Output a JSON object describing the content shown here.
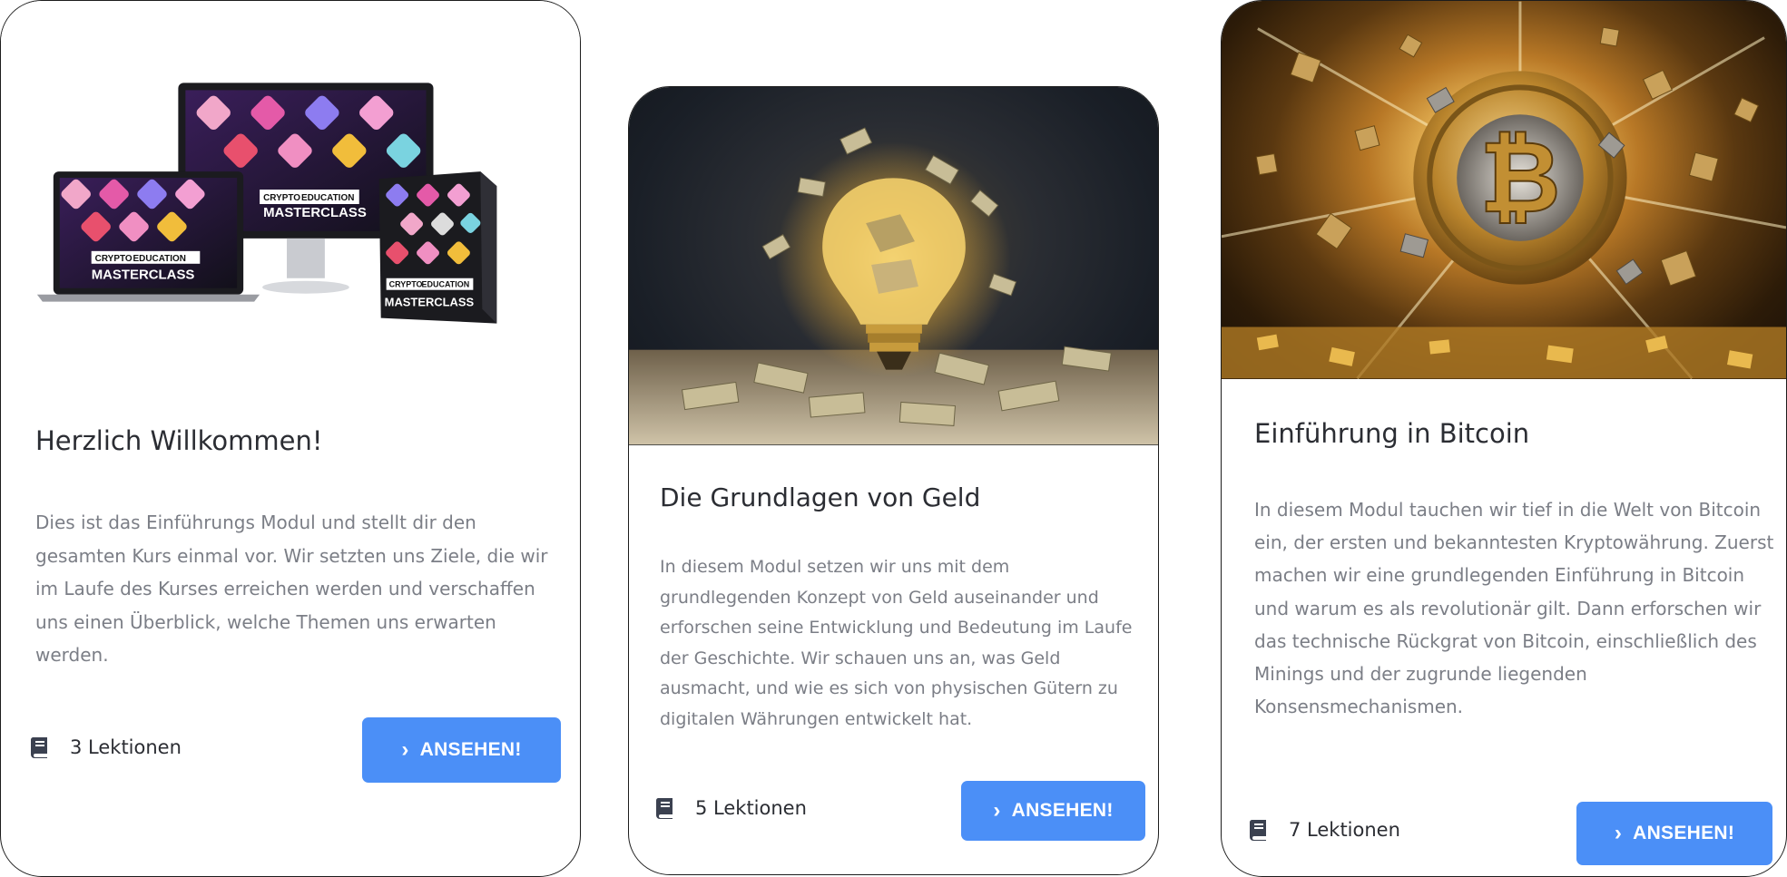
{
  "cards": [
    {
      "title": "Herzlich Willkommen!",
      "description": "Dies ist das Einführungs Modul und stellt dir den gesamten Kurs einmal vor. Wir setzten uns Ziele, die wir im Laufe des Kurses erreichen werden und verschaffen uns einen Überblick, welche Themen uns erwarten werden.",
      "lessons": "3 Lektionen",
      "button_label": "ANSEHEN!",
      "image": {
        "brand_top": "CRYPTO",
        "brand_word": "EDUCATION",
        "product": "MASTERCLASS"
      }
    },
    {
      "title": "Die Grundlagen von Geld",
      "description": "In diesem Modul setzen wir uns mit dem grundlegenden Konzept von Geld auseinander und erforschen seine Entwicklung und Bedeutung im Laufe der Geschichte. Wir schauen uns an, was Geld ausmacht, und wie es sich von physischen Gütern zu digitalen Währungen entwickelt hat.",
      "lessons": "5 Lektionen",
      "button_label": "ANSEHEN!"
    },
    {
      "title": "Einführung in Bitcoin",
      "description": "In diesem Modul tauchen wir tief in die Welt von Bitcoin ein, der ersten und bekanntesten Kryptowährung. Zuerst machen wir eine grundlegenden Einführung in Bitcoin und warum es als revolutionär gilt. Dann erforschen wir das technische Rückgrat von Bitcoin, einschließlich des Minings und der zugrunde liegenden Konsensmechanismen.",
      "lessons": "7 Lektionen",
      "button_label": "ANSEHEN!"
    }
  ],
  "icons": {
    "lessons": "book-icon",
    "button": "chevron-right-icon"
  },
  "colors": {
    "button": "#4b8ff7",
    "title": "#2b2d33",
    "description": "#7b7e86",
    "card_border": "#1c1c1c"
  }
}
